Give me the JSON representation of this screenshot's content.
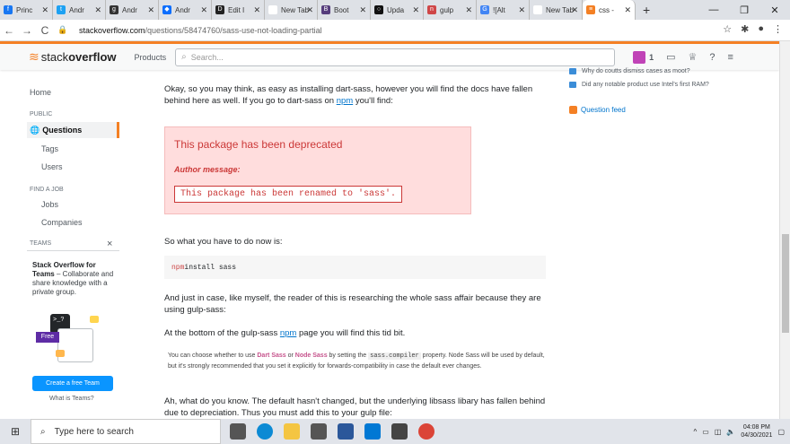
{
  "tabs": [
    {
      "label": "Princ",
      "color": "#1877f2",
      "glyph": "f"
    },
    {
      "label": "Andr",
      "color": "#1da1f2",
      "glyph": "t"
    },
    {
      "label": "Andr",
      "color": "#333333",
      "glyph": "g"
    },
    {
      "label": "Andr",
      "color": "#0d6efd",
      "glyph": "◆"
    },
    {
      "label": "Edit I",
      "color": "#222222",
      "glyph": "D"
    },
    {
      "label": "New Tab",
      "color": "#ffffff",
      "glyph": ""
    },
    {
      "label": "Boot",
      "color": "#563d7c",
      "glyph": "B"
    },
    {
      "label": "Upda",
      "color": "#111111",
      "glyph": "○"
    },
    {
      "label": "gulp",
      "color": "#cf4647",
      "glyph": "n"
    },
    {
      "label": "![Alt",
      "color": "#4285f4",
      "glyph": "G"
    },
    {
      "label": "New Tab",
      "color": "#ffffff",
      "glyph": ""
    },
    {
      "label": "css -",
      "color": "#f48024",
      "glyph": "≡"
    }
  ],
  "browser": {
    "url_host": "stackoverflow.com",
    "url_path": "/questions/58474760/sass-use-not-loading-partial"
  },
  "so": {
    "logo_light": "stack",
    "logo_bold": "overflow",
    "products": "Products",
    "search_placeholder": "Search...",
    "inbox_count": "1"
  },
  "sidebar": {
    "home": "Home",
    "public": "PUBLIC",
    "questions": "Questions",
    "tags": "Tags",
    "users": "Users",
    "find_job": "FIND A JOB",
    "jobs": "Jobs",
    "companies": "Companies",
    "teams": "TEAMS",
    "teams_close": "×",
    "teams_title": "Stack Overflow for Teams",
    "teams_desc": " – Collaborate and share knowledge with a private group.",
    "free": "Free",
    "create_btn": "Create a free Team",
    "what": "What is Teams?"
  },
  "content": {
    "p1a": "Okay, so you may think, as easy as installing dart-sass, however you will find the docs have fallen behind here as well. If you go to dart-sass on ",
    "p1link": "npm",
    "p1b": " you'll find:",
    "dep_title": "This package has been deprecated",
    "dep_author": "Author message:",
    "dep_msg": "This package has been renamed to 'sass'.",
    "p2": "So what you have to do now is:",
    "code_kw": "npm",
    "code_rest": " install sass",
    "p3": "And just in case, like myself, the reader of this is researching the whole sass affair because they are using gulp-sass:",
    "p4a": "At the bottom of the gulp-sass ",
    "p4link": "npm",
    "p4b": " page you will find this tid bit.",
    "note_a": "You can choose whether to use ",
    "note_dart": "Dart Sass",
    "note_or": " or ",
    "note_node": "Node Sass",
    "note_b": " by setting the ",
    "note_code": "sass.compiler",
    "note_c": " property. Node Sass will be used by default, but it's strongly recommended that you set it explicitly for forwards-compatibility in case the default ever changes.",
    "p5": "Ah, what do you know. The default hasn't changed, but the underlying libsass libary has fallen behind due to depreciation. Thus you must add this to your gulp file:"
  },
  "right": {
    "q1": "Why do coutts dismiss cases as moot?",
    "q2": "Did any notable product use Intel's first RAM?",
    "feed": "Question feed"
  },
  "taskbar": {
    "search": "Type here to search",
    "time": "04:08 PM",
    "date": "04/30/2021"
  }
}
